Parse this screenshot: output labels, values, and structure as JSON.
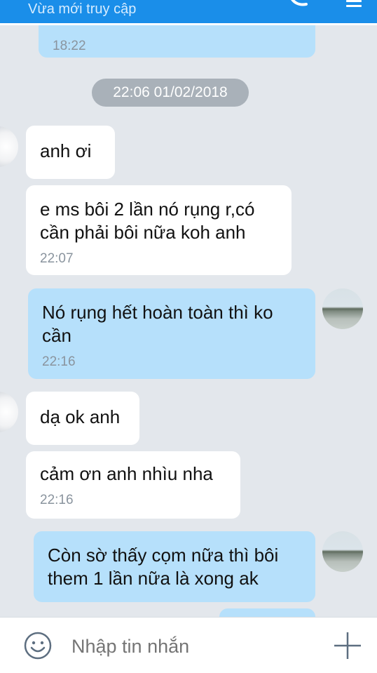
{
  "header": {
    "status": "Vừa mới truy cập",
    "background_color": "#1a8ee9",
    "icons": [
      "phone-call-icon",
      "menu-icon"
    ]
  },
  "chat": {
    "date_divider": "22:06 01/02/2018",
    "messages": [
      {
        "side": "out",
        "text": "",
        "time": "18:22"
      },
      {
        "side": "in",
        "text": "anh ơi",
        "time": ""
      },
      {
        "side": "in",
        "text": "e ms bôi 2 lần nó rụng r,có cần phải bôi nữa koh anh",
        "time": "22:07"
      },
      {
        "side": "out",
        "text": "Nó rụng hết hoàn toàn thì ko cần",
        "time": "22:16"
      },
      {
        "side": "in",
        "text": "dạ ok anh",
        "time": ""
      },
      {
        "side": "in",
        "text": "cảm ơn anh nhìu nha",
        "time": "22:16"
      },
      {
        "side": "out",
        "text": "Còn sờ thấy cọm nữa thì bôi them 1 lần nữa là xong ak",
        "time": ""
      }
    ],
    "incoming_color": "#ffffff",
    "outgoing_color": "#b6e0fb"
  },
  "composer": {
    "placeholder": "Nhập tin nhắn",
    "icons": [
      "emoji-icon",
      "plus-icon"
    ]
  }
}
